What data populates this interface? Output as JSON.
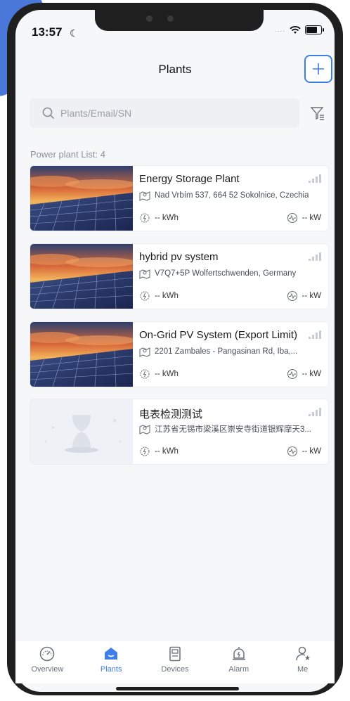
{
  "status": {
    "time": "13:57"
  },
  "header": {
    "title": "Plants"
  },
  "search": {
    "placeholder": "Plants/Email/SN"
  },
  "list": {
    "count_label": "Power plant List: 4",
    "plants": [
      {
        "name": "Energy Storage Plant",
        "address": "Nad Vrbím 537, 664 52 Sokolnice, Czechia",
        "energy": "-- kWh",
        "power": "-- kW",
        "image": "solar-panel-sunset"
      },
      {
        "name": "hybrid pv system",
        "address": "V7Q7+5P Wolfertschwenden, Germany",
        "energy": "-- kWh",
        "power": "-- kW",
        "image": "solar-panel-sunset"
      },
      {
        "name": "On-Grid PV System (Export Limit)",
        "address": "2201 Zambales - Pangasinan Rd, Iba,...",
        "energy": "-- kWh",
        "power": "-- kW",
        "image": "solar-panel-sunset"
      },
      {
        "name": "电表检测测试",
        "address": "江苏省无锡市梁溪区崇安寺街道银辉摩天3...",
        "energy": "-- kWh",
        "power": "-- kW",
        "image": "hourglass-placeholder"
      }
    ]
  },
  "tabs": [
    {
      "label": "Overview",
      "icon": "gauge-icon",
      "active": false
    },
    {
      "label": "Plants",
      "icon": "home-icon",
      "active": true
    },
    {
      "label": "Devices",
      "icon": "device-icon",
      "active": false
    },
    {
      "label": "Alarm",
      "icon": "alarm-bell-icon",
      "active": false
    },
    {
      "label": "Me",
      "icon": "user-star-icon",
      "active": false
    }
  ],
  "colors": {
    "accent": "#3f7ee8",
    "background": "#f6f7f9"
  }
}
